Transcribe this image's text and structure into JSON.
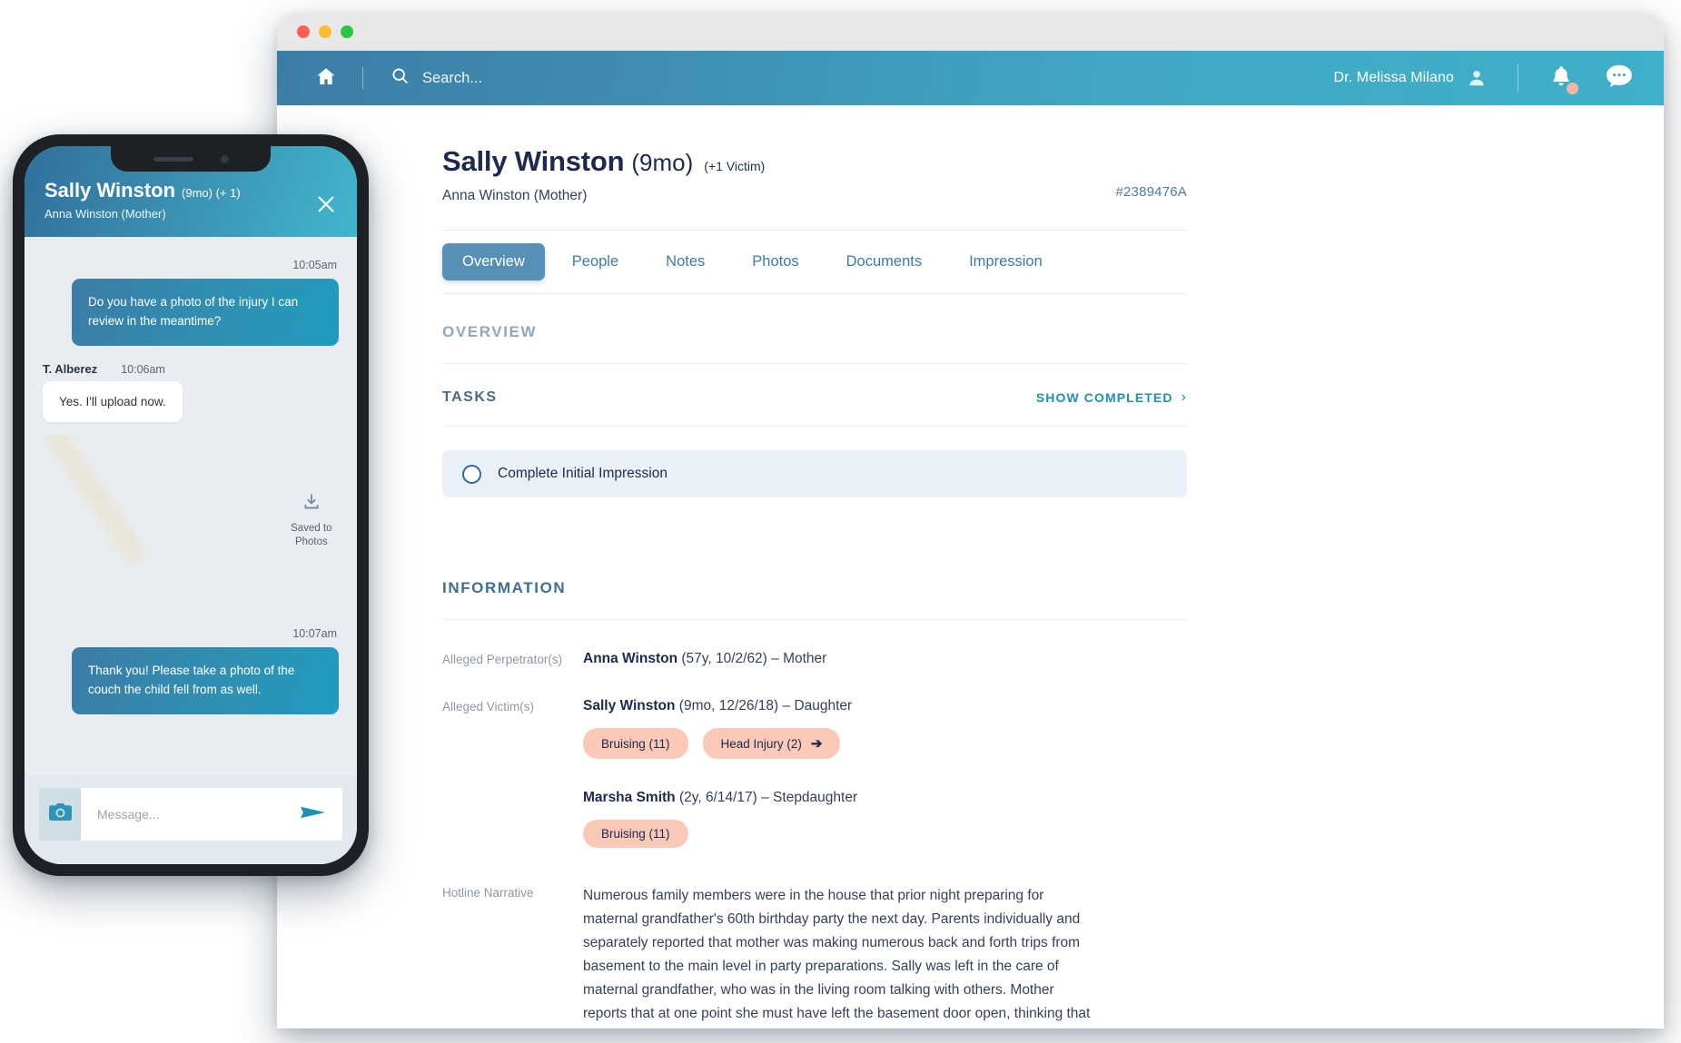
{
  "window": {
    "traffic_lights": [
      "close",
      "minimize",
      "maximize"
    ]
  },
  "appbar": {
    "home_icon": "home-icon",
    "search_icon": "search-icon",
    "search_value": "",
    "search_placeholder": "Search...",
    "user_name": "Dr. Melissa Milano",
    "user_icon": "person-icon",
    "notification_icon": "bell-icon",
    "messages_icon": "chat-bubble-icon",
    "accent_gradient_start": "#3c7da6",
    "accent_gradient_end": "#3fb0c9",
    "badge_color": "#f7b6a1"
  },
  "case": {
    "name": "Sally Winston",
    "age": "(9mo)",
    "extra_victims": "(+1 Victim)",
    "guardian": "Anna Winston (Mother)",
    "case_id": "#2389476A"
  },
  "tabs": [
    {
      "label": "Overview",
      "active": true
    },
    {
      "label": "People",
      "active": false
    },
    {
      "label": "Notes",
      "active": false
    },
    {
      "label": "Photos",
      "active": false
    },
    {
      "label": "Documents",
      "active": false
    },
    {
      "label": "Impression",
      "active": false
    }
  ],
  "overview": {
    "section_title": "OVERVIEW",
    "tasks_label": "TASKS",
    "show_completed": "SHOW COMPLETED",
    "show_completed_chevron": "›",
    "tasks": [
      {
        "label": "Complete Initial Impression",
        "done": false
      }
    ]
  },
  "information": {
    "section_title": "INFORMATION",
    "perpetrator_label": "Alleged Perpetrator(s)",
    "perpetrator_name": "Anna Winston",
    "perpetrator_detail": " (57y, 10/2/62) – Mother",
    "victim_label": "Alleged Victim(s)",
    "victims": [
      {
        "name": "Sally Winston",
        "detail": " (9mo, 12/26/18) – Daughter",
        "chips": [
          {
            "label": "Bruising (11)",
            "arrow": ""
          },
          {
            "label": "Head Injury (2)",
            "arrow": "➔"
          }
        ]
      },
      {
        "name": "Marsha Smith",
        "detail": " (2y, 6/14/17) – Stepdaughter",
        "chips": [
          {
            "label": "Bruising (11)",
            "arrow": ""
          }
        ]
      }
    ],
    "narrative_label": "Hotline Narrative",
    "narrative_text": "Numerous family members were in the house that prior night preparing for maternal grandfather's 60th birthday party the next day. Parents individually and separately reported that mother was making numerous back and forth trips from basement to the main level in party preparations.  Sally was left in the care of maternal grandfather, who was in the living room talking with others.  Mother reports that at one point she must have left the basement door open, thinking that grandfather was watching the",
    "chip_color": "#fbc9b7"
  },
  "phone": {
    "header": {
      "name": "Sally Winston",
      "meta": "(9mo) (+ 1)",
      "subtitle": "Anna Winston (Mother)",
      "close_icon": "close-icon"
    },
    "messages": [
      {
        "type": "outgoing",
        "timestamp": "10:05am",
        "text": "Do you have a photo of the injury I can review in the meantime?"
      },
      {
        "type": "incoming",
        "sender": "T. Alberez",
        "timestamp": "10:06am",
        "text": "Yes. I'll upload now."
      },
      {
        "type": "attachment",
        "saved_label": "Saved to Photos",
        "download_icon": "download-icon"
      },
      {
        "type": "outgoing",
        "timestamp": "10:07am",
        "text": "Thank you! Please take a photo of the couch the child fell from as well."
      }
    ],
    "composer": {
      "camera_icon": "camera-icon",
      "message_value": "",
      "message_placeholder": "Message...",
      "send_icon": "send-icon"
    }
  }
}
